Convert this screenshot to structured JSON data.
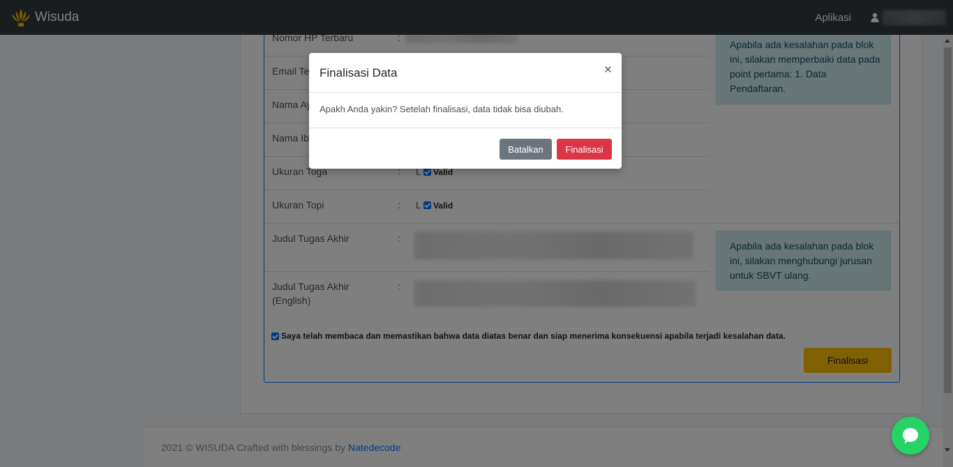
{
  "navbar": {
    "brand": "Wisuda",
    "menu_label": "Aplikasi"
  },
  "form": {
    "fields": [
      {
        "label": "Nomor HP Terbaru"
      },
      {
        "label": "Email Ter"
      },
      {
        "label": "Nama Ay"
      },
      {
        "label": "Nama Ibu"
      },
      {
        "label": "Ukuran Toga",
        "value": "L",
        "status": "Valid"
      },
      {
        "label": "Ukuran Topi",
        "value": "L",
        "status": "Valid"
      },
      {
        "label": "Judul Tugas Akhir"
      },
      {
        "label_line1": "Judul Tugas Akhir",
        "label_line2": "(English)"
      }
    ],
    "colon": ":",
    "alert_top": [
      "Apabila ada kesalahan pada blok",
      "ini, silakan memperbaiki data pada",
      "point pertama: 1. Data",
      "Pendaftaran."
    ],
    "alert_bottom": [
      "Apabila ada kesalahan pada blok",
      "ini, silakan menghubungi jurusan",
      "untuk SBVT ulang."
    ],
    "consent": "Saya telah membaca dan memastikan bahwa data diatas benar dan siap menerima konsekuensi apabila terjadi kesalahan data.",
    "finalize_button": "Finalisasi"
  },
  "footer": {
    "text": "2021 © WISUDA Crafted with blessings by ",
    "link": "Natedecode"
  },
  "modal": {
    "title": "Finalisasi Data",
    "close": "×",
    "body": "Apakh Anda yakin? Setelah finalisasi, data tidak bisa diubah.",
    "cancel_label": "Batalkan",
    "confirm_label": "Finalisasi"
  },
  "colors": {
    "navbar": "#343a40",
    "primary": "#007bff",
    "warning": "#ffc107",
    "danger": "#dc3545",
    "secondary": "#6c757d",
    "info_bg": "#d1ecf1",
    "whatsapp": "#25d366"
  },
  "icons": [
    "logo-icon",
    "user-icon",
    "close-icon",
    "whatsapp-chat-icon",
    "checkbox-icon"
  ]
}
